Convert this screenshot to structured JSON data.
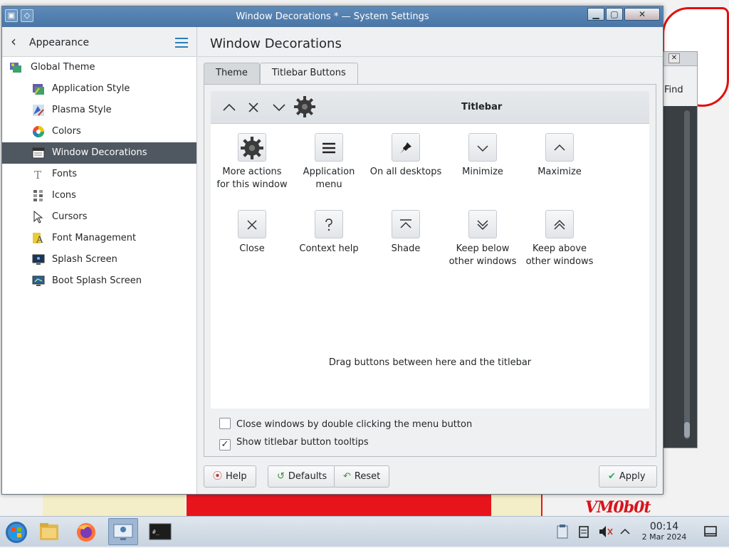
{
  "window": {
    "title": "Window Decorations * — System Settings",
    "buttons": {
      "minimize": "▁",
      "maximize": "▢",
      "close": "✕"
    }
  },
  "sidebar": {
    "header": "Appearance",
    "items": [
      {
        "label": "Global Theme",
        "icon": "global-theme-icon",
        "level": "top"
      },
      {
        "label": "Application Style",
        "icon": "application-style-icon",
        "level": "sub"
      },
      {
        "label": "Plasma Style",
        "icon": "plasma-style-icon",
        "level": "sub"
      },
      {
        "label": "Colors",
        "icon": "colors-icon",
        "level": "sub"
      },
      {
        "label": "Window Decorations",
        "icon": "window-decorations-icon",
        "level": "sub",
        "active": true
      },
      {
        "label": "Fonts",
        "icon": "fonts-icon",
        "level": "sub"
      },
      {
        "label": "Icons",
        "icon": "icons-icon",
        "level": "sub"
      },
      {
        "label": "Cursors",
        "icon": "cursors-icon",
        "level": "sub"
      },
      {
        "label": "Font Management",
        "icon": "font-management-icon",
        "level": "sub"
      },
      {
        "label": "Splash Screen",
        "icon": "splash-screen-icon",
        "level": "sub"
      },
      {
        "label": "Boot Splash Screen",
        "icon": "boot-splash-screen-icon",
        "level": "sub"
      }
    ]
  },
  "content": {
    "title": "Window Decorations",
    "tabs": [
      {
        "label": "Theme",
        "active": false
      },
      {
        "label": "Titlebar Buttons",
        "active": true
      }
    ],
    "titlebar_preview": {
      "label": "Titlebar",
      "buttons": [
        "maximize-icon",
        "close-icon",
        "minimize-icon",
        "gear-icon"
      ]
    },
    "palette": [
      {
        "label": "More actions for this window",
        "lines": [
          "More actions",
          "for this window"
        ],
        "icon": "gear-icon"
      },
      {
        "label": "Application menu",
        "lines": [
          "Application",
          "menu"
        ],
        "icon": "hamburger-menu-icon"
      },
      {
        "label": "On all desktops",
        "lines": [
          "On all desktops"
        ],
        "icon": "pin-icon"
      },
      {
        "label": "Minimize",
        "lines": [
          "Minimize"
        ],
        "icon": "minimize-icon"
      },
      {
        "label": "Maximize",
        "lines": [
          "Maximize"
        ],
        "icon": "maximize-icon"
      },
      {
        "label": "Close",
        "lines": [
          "Close"
        ],
        "icon": "close-icon"
      },
      {
        "label": "Context help",
        "lines": [
          "Context help"
        ],
        "icon": "help-icon"
      },
      {
        "label": "Shade",
        "lines": [
          "Shade"
        ],
        "icon": "shade-icon"
      },
      {
        "label": "Keep below other windows",
        "lines": [
          "Keep below",
          "other windows"
        ],
        "icon": "keep-below-icon"
      },
      {
        "label": "Keep above other windows",
        "lines": [
          "Keep above",
          "other windows"
        ],
        "icon": "keep-above-icon"
      }
    ],
    "drag_hint": "Drag buttons between here and the titlebar",
    "options": [
      {
        "label": "Close windows by double clicking the menu button",
        "checked": false
      },
      {
        "label": "Show titlebar button tooltips",
        "checked": true
      }
    ]
  },
  "footer": {
    "help": "Help",
    "defaults": "Defaults",
    "reset": "Reset",
    "apply": "Apply"
  },
  "background_window": {
    "find_label": "Find"
  },
  "desktop": {
    "watermark": "VM0b0t"
  },
  "taskbar": {
    "apps": [
      "start-menu-icon",
      "file-manager-icon",
      "firefox-icon",
      "system-settings-icon",
      "terminal-icon"
    ],
    "tray": [
      "clipboard-icon",
      "notes-icon",
      "volume-muted-icon",
      "tray-expand-icon"
    ],
    "time": "00:14",
    "date": "2 Mar 2024"
  },
  "colors": {
    "accent": "#2980b9",
    "selection": "#4f5861",
    "titlebar": "#4a76a6",
    "apply_check": "#27ae60"
  }
}
